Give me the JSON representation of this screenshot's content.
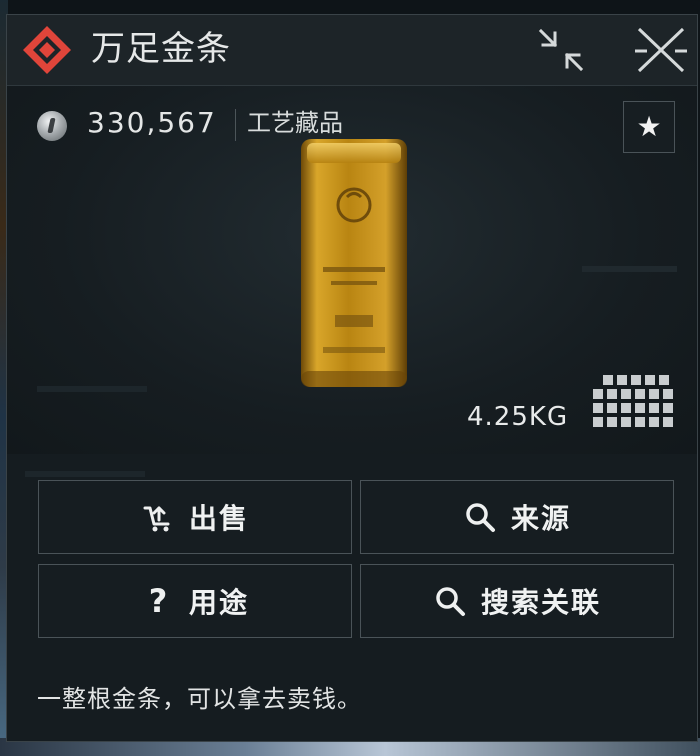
{
  "window": {
    "title": "万足金条",
    "collapse_icon": "collapse-arrows-icon",
    "close_icon": "close-x-icon",
    "logo_icon": "red-diamond-logo-icon"
  },
  "item": {
    "currency_icon": "silver-coin-icon",
    "price": "330,567",
    "category": "工艺藏品",
    "favorite_icon": "star-icon",
    "favorite_glyph": "★",
    "weight": "4.25KG",
    "size_grid_icon": "inventory-grid-icon",
    "image": "gold-bar"
  },
  "actions": [
    {
      "label": "出售",
      "icon": "sell-cart-icon"
    },
    {
      "label": "来源",
      "icon": "search-icon"
    },
    {
      "label": "用途",
      "icon": "question-mark-icon",
      "glyph": "?"
    },
    {
      "label": "搜索关联",
      "icon": "search-icon"
    }
  ],
  "description": "一整根金条，可以拿去卖钱。",
  "colors": {
    "accent_red": "#e0453a",
    "gold": "#c8931c",
    "panel_bg": "#151c20",
    "text": "#e6e8e8"
  }
}
